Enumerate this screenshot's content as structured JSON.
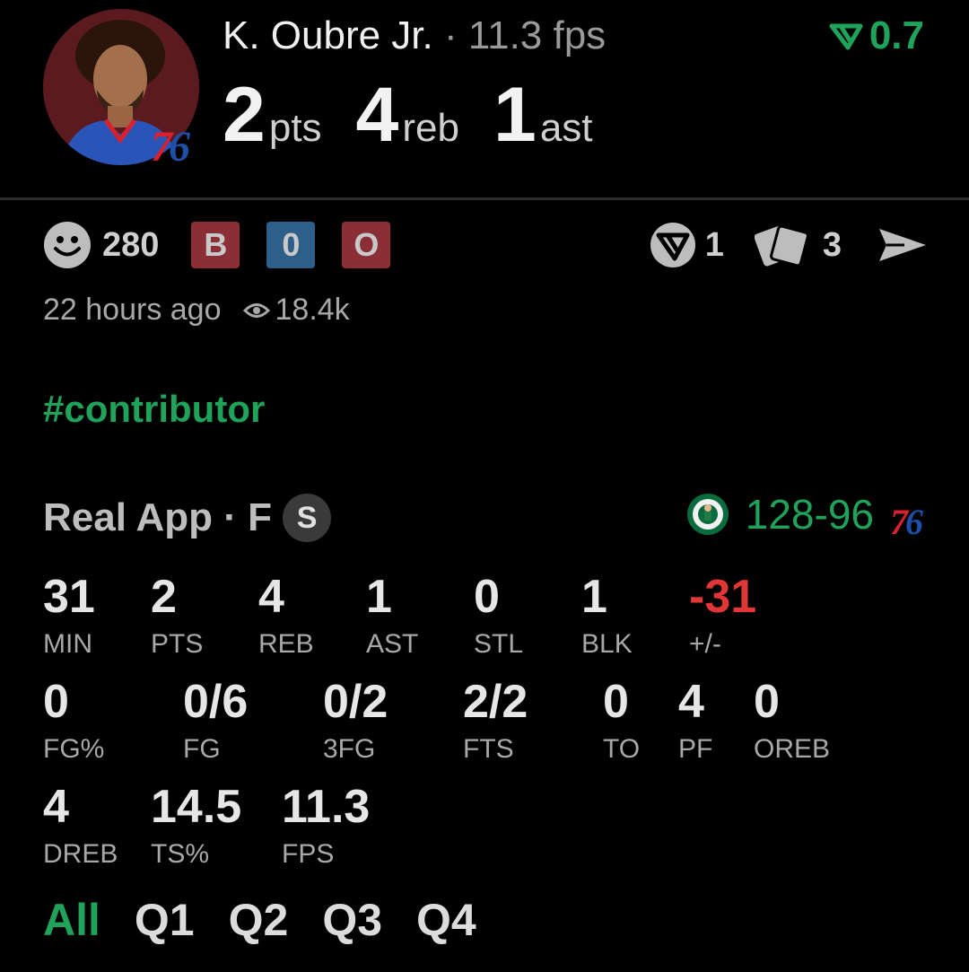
{
  "header": {
    "player_name": "K. Oubre Jr.",
    "separator": "·",
    "fps_text": "11.3 fps",
    "rating_value": "0.7",
    "team_logo": {
      "seven": "7",
      "six": "6"
    },
    "statline": [
      {
        "value": "2",
        "unit": "pts"
      },
      {
        "value": "4",
        "unit": "reb"
      },
      {
        "value": "1",
        "unit": "ast"
      }
    ]
  },
  "reactions": {
    "smiley_count": "280",
    "chips": [
      {
        "label": "B",
        "color": "#8a2f36"
      },
      {
        "label": "0",
        "color": "#2e5e8a"
      },
      {
        "label": "O",
        "color": "#8a2f36"
      }
    ],
    "rating_action_count": "1",
    "cards_count": "3"
  },
  "meta": {
    "time_ago": "22 hours ago",
    "views": "18.4k"
  },
  "hashtag": "#contributor",
  "game": {
    "source": "Real App · F",
    "status_badge": "S",
    "score": "128-96",
    "away_logo": {
      "seven": "7",
      "six": "6"
    }
  },
  "box": {
    "row1": [
      {
        "value": "31",
        "label": "MIN"
      },
      {
        "value": "2",
        "label": "PTS"
      },
      {
        "value": "4",
        "label": "REB"
      },
      {
        "value": "1",
        "label": "AST"
      },
      {
        "value": "0",
        "label": "STL"
      },
      {
        "value": "1",
        "label": "BLK"
      },
      {
        "value": "-31",
        "label": "+/-"
      }
    ],
    "row2": [
      {
        "value": "0",
        "label": "FG%"
      },
      {
        "value": "0/6",
        "label": "FG"
      },
      {
        "value": "0/2",
        "label": "3FG"
      },
      {
        "value": "2/2",
        "label": "FTS"
      },
      {
        "value": "0",
        "label": "TO"
      },
      {
        "value": "4",
        "label": "PF"
      },
      {
        "value": "0",
        "label": "OREB"
      }
    ],
    "row3": [
      {
        "value": "4",
        "label": "DREB"
      },
      {
        "value": "14.5",
        "label": "TS%"
      },
      {
        "value": "11.3",
        "label": "FPS"
      }
    ]
  },
  "tabs": [
    "All",
    "Q1",
    "Q2",
    "Q3",
    "Q4"
  ],
  "colors": {
    "accent_green": "#1fa35b",
    "negative_red": "#e03636",
    "background": "#000000"
  },
  "icons": [
    "smiley-icon",
    "rating-v-icon",
    "cards-icon",
    "send-icon",
    "eye-icon",
    "celtics-logo-icon"
  ]
}
